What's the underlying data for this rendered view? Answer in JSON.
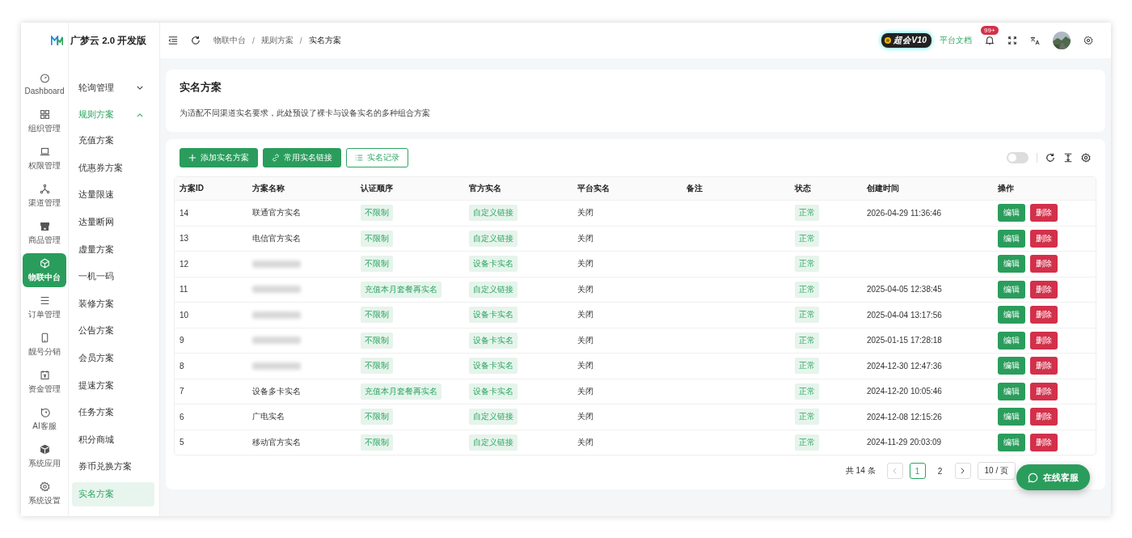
{
  "app": {
    "logo_text": "广梦云 2.0 开发版"
  },
  "rail": [
    {
      "label": "Dashboard",
      "selected": false
    },
    {
      "label": "组织管理",
      "selected": false
    },
    {
      "label": "权限管理",
      "selected": false
    },
    {
      "label": "渠道管理",
      "selected": false
    },
    {
      "label": "商品管理",
      "selected": false
    },
    {
      "label": "物联中台",
      "selected": true
    },
    {
      "label": "订单管理",
      "selected": false
    },
    {
      "label": "靓号分销",
      "selected": false
    },
    {
      "label": "资金管理",
      "selected": false
    },
    {
      "label": "AI客服",
      "selected": false
    },
    {
      "label": "系统应用",
      "selected": false
    },
    {
      "label": "系统设置",
      "selected": false
    }
  ],
  "submenu": [
    {
      "label": "轮询管理",
      "expanded": false
    },
    {
      "label": "规则方案",
      "expanded": true,
      "children": [
        {
          "label": "充值方案",
          "selected": false
        },
        {
          "label": "优惠券方案",
          "selected": false
        },
        {
          "label": "达量限速",
          "selected": false
        },
        {
          "label": "达量断网",
          "selected": false
        },
        {
          "label": "虚量方案",
          "selected": false
        },
        {
          "label": "一机一码",
          "selected": false
        },
        {
          "label": "装修方案",
          "selected": false
        },
        {
          "label": "公告方案",
          "selected": false
        },
        {
          "label": "会员方案",
          "selected": false
        },
        {
          "label": "提速方案",
          "selected": false
        },
        {
          "label": "任务方案",
          "selected": false
        },
        {
          "label": "积分商城",
          "selected": false
        },
        {
          "label": "券币兑换方案",
          "selected": false
        },
        {
          "label": "实名方案",
          "selected": true
        }
      ]
    }
  ],
  "header": {
    "breadcrumb": [
      "物联中台",
      "规则方案",
      "实名方案"
    ],
    "breadcrumb_separator": "/",
    "vip_badge": "超会V10",
    "docs_link": "平台文档",
    "notification_count": "99+"
  },
  "page_header": {
    "title": "实名方案",
    "description": "为适配不同渠道实名要求，此处预设了裸卡与设备实名的多种组合方案"
  },
  "toolbar": {
    "buttons": [
      {
        "label": "添加实名方案",
        "kind": "add"
      },
      {
        "label": "常用实名链接",
        "kind": "link"
      },
      {
        "label": "实名记录",
        "kind": "records"
      }
    ],
    "toggle": {
      "on": false
    }
  },
  "table": {
    "columns": [
      "方案ID",
      "方案名称",
      "认证顺序",
      "官方实名",
      "平台实名",
      "备注",
      "状态",
      "创建时间",
      "操作"
    ],
    "rows": [
      {
        "id": "14",
        "name": "联通官方实名",
        "auth_order": "不限制",
        "official": "自定义链接",
        "platform": "关闭",
        "status": "正常",
        "created": "2026-04-29 11:36:46",
        "actions": [
          "编辑",
          "删除"
        ]
      },
      {
        "id": "13",
        "name": "电信官方实名",
        "auth_order": "不限制",
        "official": "自定义链接",
        "platform": "关闭",
        "status": "正常",
        "actions": [
          "编辑",
          "删除"
        ]
      },
      {
        "id": "12",
        "redacted": true,
        "auth_order": "不限制",
        "official": "设备卡实名",
        "platform": "关闭",
        "status": "正常",
        "actions": [
          "编辑",
          "删除"
        ]
      },
      {
        "id": "11",
        "redacted": true,
        "auth_order": "充值本月套餐再实名",
        "official": "自定义链接",
        "platform": "关闭",
        "status": "正常",
        "created": "2025-04-05 12:38:45",
        "actions": [
          "编辑",
          "删除"
        ]
      },
      {
        "id": "10",
        "redacted": true,
        "auth_order": "不限制",
        "official": "设备卡实名",
        "platform": "关闭",
        "status": "正常",
        "created": "2025-04-04 13:17:56",
        "actions": [
          "编辑",
          "删除"
        ]
      },
      {
        "id": "9",
        "redacted": true,
        "auth_order": "不限制",
        "official": "设备卡实名",
        "platform": "关闭",
        "status": "正常",
        "created": "2025-01-15 17:28:18",
        "actions": [
          "编辑",
          "删除"
        ]
      },
      {
        "id": "8",
        "redacted": true,
        "auth_order": "不限制",
        "official": "设备卡实名",
        "platform": "关闭",
        "status": "正常",
        "created": "2024-12-30 12:47:36",
        "actions": [
          "编辑",
          "删除"
        ]
      },
      {
        "id": "7",
        "name": "设备多卡实名",
        "auth_order": "充值本月套餐再实名",
        "official": "设备卡实名",
        "platform": "关闭",
        "status": "正常",
        "created": "2024-12-20 10:05:46",
        "actions": [
          "编辑",
          "删除"
        ]
      },
      {
        "id": "6",
        "name": "广电实名",
        "auth_order": "不限制",
        "official": "自定义链接",
        "platform": "关闭",
        "status": "正常",
        "created": "2024-12-08 12:15:26",
        "actions": [
          "编辑",
          "删除"
        ]
      },
      {
        "id": "5",
        "name": "移动官方实名",
        "auth_order": "不限制",
        "official": "自定义链接",
        "platform": "关闭",
        "status": "正常",
        "created": "2024-11-29 20:03:09",
        "actions": [
          "编辑",
          "删除"
        ]
      }
    ]
  },
  "pagination": {
    "total": "共 14 条",
    "pages": [
      {
        "label": "1",
        "selected": true
      },
      {
        "label": "2",
        "selected": false
      }
    ],
    "page_size": "10 / 页"
  },
  "chat_button": "在线客服"
}
